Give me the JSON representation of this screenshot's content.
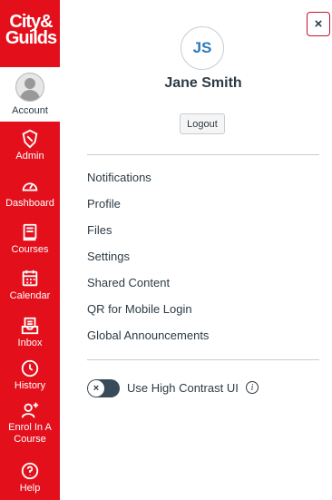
{
  "sidebar": {
    "logo": {
      "line1": "City&",
      "line2": "Guilds"
    },
    "account_label": "Account",
    "items": [
      {
        "label": "Admin",
        "icon": "shield-icon"
      },
      {
        "label": "Dashboard",
        "icon": "speedometer-icon"
      },
      {
        "label": "Courses",
        "icon": "book-icon"
      },
      {
        "label": "Calendar",
        "icon": "calendar-icon"
      },
      {
        "label": "Inbox",
        "icon": "inbox-icon"
      },
      {
        "label": "History",
        "icon": "clock-icon"
      },
      {
        "label": "Enrol In A Course",
        "icon": "add-user-icon"
      },
      {
        "label": "Help",
        "icon": "help-icon"
      }
    ]
  },
  "tray": {
    "close_label": "×",
    "avatar_initials": "JS",
    "user_name": "Jane Smith",
    "logout_label": "Logout",
    "links": [
      "Notifications",
      "Profile",
      "Files",
      "Settings",
      "Shared Content",
      "QR for Mobile Login",
      "Global Announcements"
    ],
    "high_contrast": {
      "label": "Use High Contrast UI",
      "enabled": false,
      "knob_symbol": "×",
      "info_symbol": "i"
    }
  },
  "colors": {
    "brand_red": "#e3101c",
    "text": "#2d3b45",
    "link_blue": "#2b7abc",
    "toggle_bg": "#394b58"
  }
}
